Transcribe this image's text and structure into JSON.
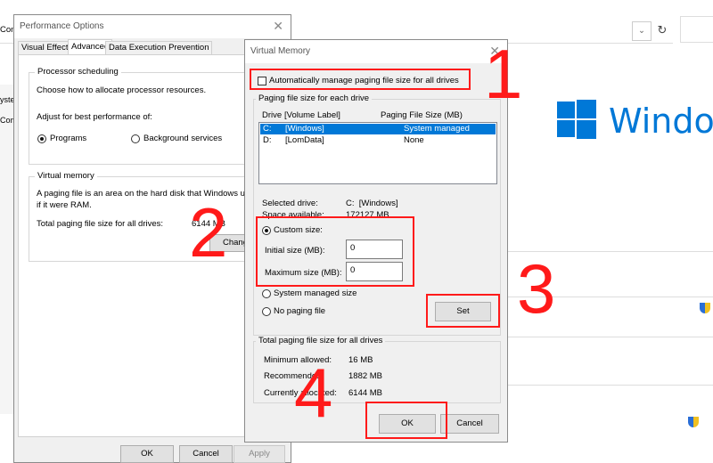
{
  "background": {
    "addr_fragment": "Con",
    "refresh_icon": "refresh-icon",
    "side_fragment": "yste",
    "side_fragment2": "Com",
    "windows_logo_text": "Window",
    "windows_logo_color": "#0078d7"
  },
  "perf": {
    "title": "Performance Options",
    "tabs": [
      "Visual Effects",
      "Advanced",
      "Data Execution Prevention"
    ],
    "processor": {
      "title": "Processor scheduling",
      "desc": "Choose how to allocate processor resources.",
      "adjust": "Adjust for best performance of:",
      "opt_programs": "Programs",
      "opt_background": "Background services"
    },
    "vm": {
      "title": "Virtual memory",
      "desc_line1": "A paging file is an area on the hard disk that Windows us",
      "desc_line2": "if it were RAM.",
      "total_label": "Total paging file size for all drives:",
      "total_value": "6144 MB",
      "change": "Chang"
    },
    "ok": "OK",
    "cancel": "Cancel",
    "apply": "Apply"
  },
  "vmdlg": {
    "title": "Virtual Memory",
    "auto_manage": "Automatically manage paging file size for all drives",
    "group1_title": "Paging file size for each drive",
    "col_drive": "Drive",
    "col_label": "[Volume Label]",
    "col_size": "Paging File Size (MB)",
    "rows": [
      {
        "drive": "C:",
        "label": "[Windows]",
        "size": "System managed"
      },
      {
        "drive": "D:",
        "label": "[LomData]",
        "size": "None"
      }
    ],
    "selected_drive_label": "Selected drive:",
    "selected_drive_value": "C:  [Windows]",
    "space_label": "Space available:",
    "space_value": "172127 MB",
    "custom_size": "Custom size:",
    "initial_label": "Initial size (MB):",
    "initial_value": "0",
    "max_label": "Maximum size (MB):",
    "max_value": "0",
    "system_managed": "System managed size",
    "no_paging": "No paging file",
    "set": "Set",
    "group2_title": "Total paging file size for all drives",
    "min_label": "Minimum allowed:",
    "min_value": "16 MB",
    "rec_label": "Recommended:",
    "rec_value": "1882 MB",
    "cur_label": "Currently allocated:",
    "cur_value": "6144 MB",
    "ok": "OK",
    "cancel": "Cancel"
  },
  "annotations": {
    "step1": "1",
    "step2": "2",
    "step3": "3",
    "step4": "4",
    "color": "#ff1a1a"
  }
}
